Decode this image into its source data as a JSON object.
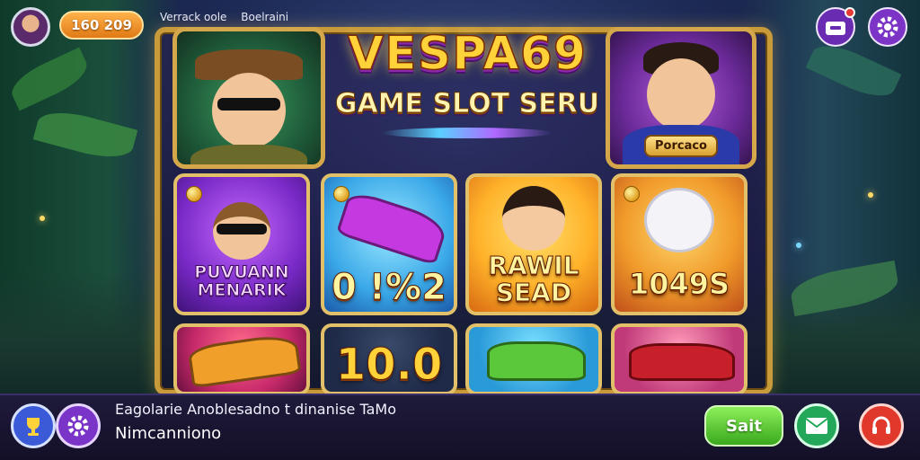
{
  "header": {
    "coin_balance": "160 209",
    "caption_left": "Verrack oole",
    "caption_right": "Boelraini"
  },
  "logo": {
    "title": "VESPA69",
    "subtitle": "GAME SLOT SERU"
  },
  "hero_right": {
    "nameplate": "Porcaco"
  },
  "tiles": [
    {
      "label": "PUVUANN MENARIK"
    },
    {
      "label": "0 !%2"
    },
    {
      "label": "RAWIL SEAD"
    },
    {
      "label": "1049S"
    },
    {
      "label": ""
    },
    {
      "label": "10.0"
    },
    {
      "label": ""
    },
    {
      "label": ""
    }
  ],
  "bottom": {
    "news_line1": "Eagolarie Anoblesadno t dinanise TaMo",
    "news_line2": "Nimcanniono",
    "start_label": "Sait"
  },
  "icons": {
    "inbox": "inbox-icon",
    "settings": "gear-icon",
    "trophy": "trophy-icon",
    "mail": "mail-icon",
    "support": "headset-icon"
  },
  "colors": {
    "frame_gold": "#c89a3a",
    "start_green": "#3aa81e",
    "support_red": "#e0382a",
    "accent_purple": "#7b34c6"
  }
}
